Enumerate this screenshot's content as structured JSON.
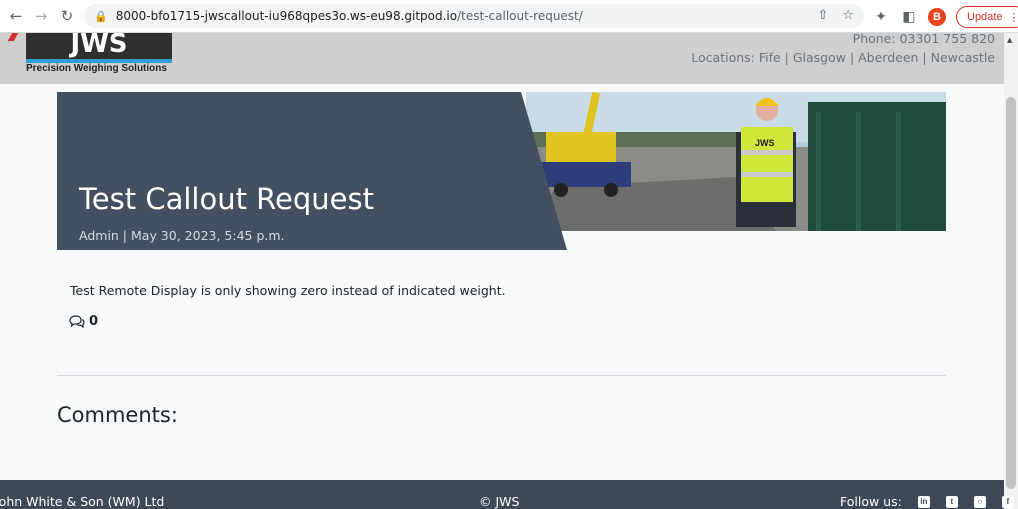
{
  "browser": {
    "url_host": "8000-bfo1715-jwscallout-iu968qpes3o.ws-eu98.gitpod.io",
    "url_path": "/test-callout-request/",
    "profile_initial": "B",
    "update_label": "Update"
  },
  "header": {
    "logo_text": "JWS",
    "logo_tagline": "Precision Weighing Solutions",
    "phone": "Phone: 03301 755 820",
    "locations": "Locations: Fife | Glasgow | Aberdeen | Newcastle"
  },
  "post": {
    "title": "Test Callout Request",
    "meta": "Admin | May 30, 2023, 5:45 p.m.",
    "body": "Test Remote Display is only showing zero instead of indicated weight.",
    "comment_count": "0",
    "image_badge": "JWS"
  },
  "comments": {
    "heading": "Comments:"
  },
  "footer": {
    "company": "John White & Son (WM) Ltd",
    "copyright": "© JWS",
    "follow_label": "Follow us:",
    "social": [
      "linkedin-icon",
      "twitter-icon",
      "instagram-icon",
      "facebook-icon"
    ]
  },
  "colors": {
    "masthead": "#435061",
    "footer": "#3d4859",
    "header": "#cfcfcf",
    "update": "#d93025"
  }
}
